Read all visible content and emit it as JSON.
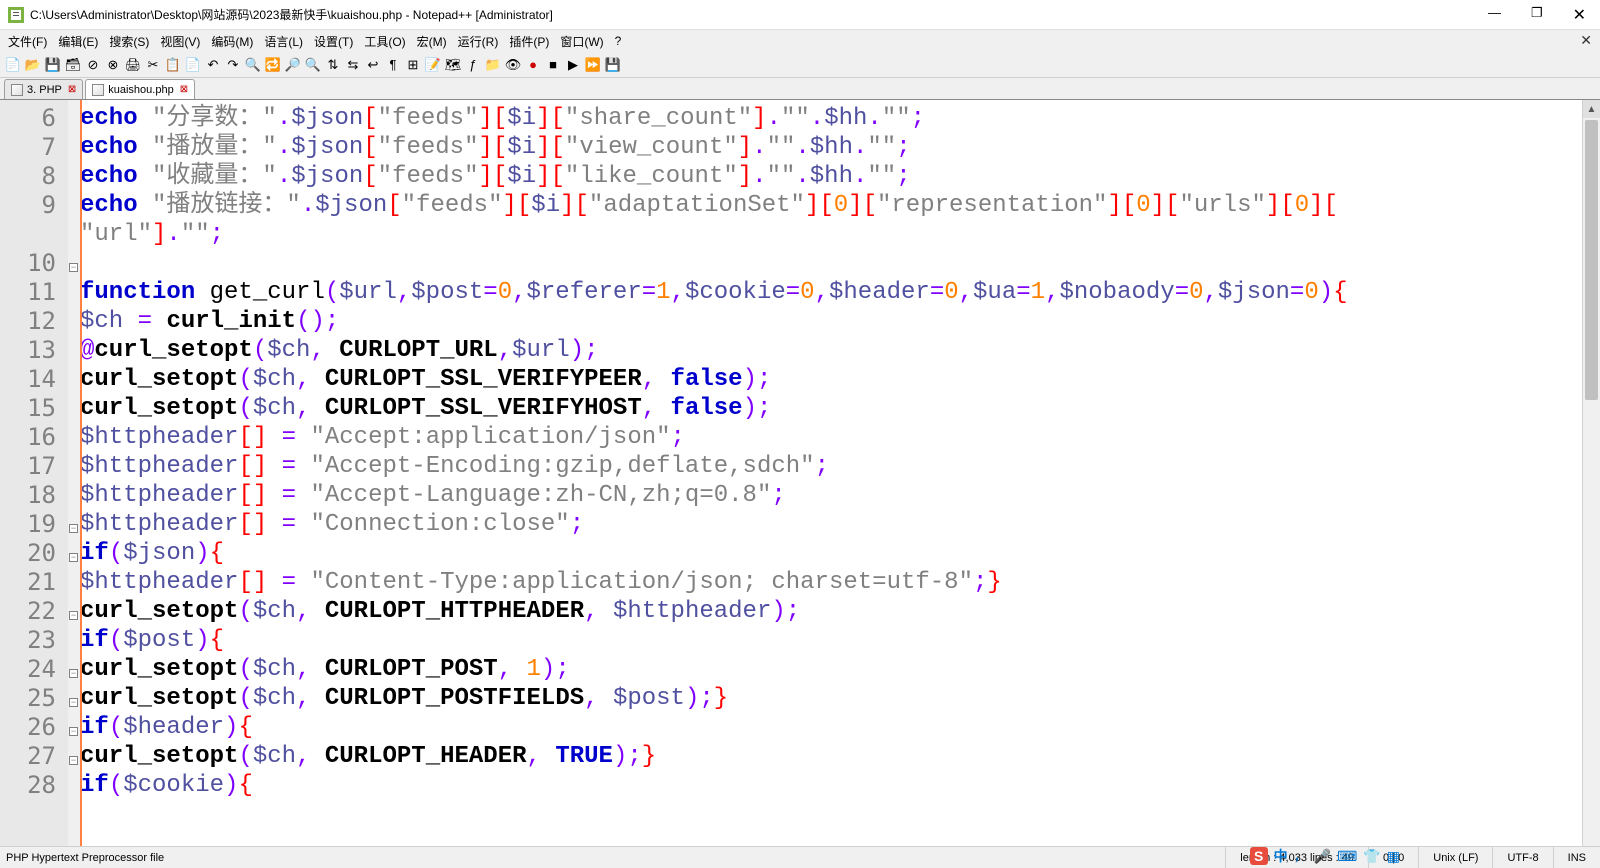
{
  "window": {
    "title": "C:\\Users\\Administrator\\Desktop\\网站源码\\2023最新快手\\kuaishou.php - Notepad++ [Administrator]"
  },
  "menu": {
    "items": [
      "文件(F)",
      "编辑(E)",
      "搜索(S)",
      "视图(V)",
      "编码(M)",
      "语言(L)",
      "设置(T)",
      "工具(O)",
      "宏(M)",
      "运行(R)",
      "插件(P)",
      "窗口(W)",
      "?"
    ]
  },
  "tabs": {
    "t1": "3. PHP",
    "t2": "kuaishou.php"
  },
  "gutter": {
    "start": 6,
    "end": 28
  },
  "fold": {
    "l11": 163,
    "l20": 424,
    "l21": 453,
    "l23": 511,
    "l25": 569,
    "l26": 598,
    "l27": 627,
    "l28": 656
  },
  "code_lines": {
    "l6": [
      [
        "kw",
        "echo"
      ],
      [
        "fn",
        " "
      ],
      [
        "str",
        "\"分享数："
      ],
      [
        "str",
        "\""
      ],
      [
        "op",
        "."
      ],
      [
        "var",
        "$json"
      ],
      [
        "brk",
        "["
      ],
      [
        "str",
        "\"feeds\""
      ],
      [
        "brk",
        "]["
      ],
      [
        "var",
        "$i"
      ],
      [
        "brk",
        "]["
      ],
      [
        "str",
        "\"share_count\""
      ],
      [
        "brk",
        "]"
      ],
      [
        "op",
        "."
      ],
      [
        "str",
        "\"\""
      ],
      [
        "op",
        "."
      ],
      [
        "var",
        "$hh"
      ],
      [
        "op",
        "."
      ],
      [
        "str",
        "\"\""
      ],
      [
        "op",
        ";"
      ]
    ],
    "l7": [
      [
        "kw",
        "echo"
      ],
      [
        "fn",
        " "
      ],
      [
        "str",
        "\"播放量："
      ],
      [
        "str",
        "\""
      ],
      [
        "op",
        "."
      ],
      [
        "var",
        "$json"
      ],
      [
        "brk",
        "["
      ],
      [
        "str",
        "\"feeds\""
      ],
      [
        "brk",
        "]["
      ],
      [
        "var",
        "$i"
      ],
      [
        "brk",
        "]["
      ],
      [
        "str",
        "\"view_count\""
      ],
      [
        "brk",
        "]"
      ],
      [
        "op",
        "."
      ],
      [
        "str",
        "\"\""
      ],
      [
        "op",
        "."
      ],
      [
        "var",
        "$hh"
      ],
      [
        "op",
        "."
      ],
      [
        "str",
        "\"\""
      ],
      [
        "op",
        ";"
      ]
    ],
    "l8": [
      [
        "kw",
        "echo"
      ],
      [
        "fn",
        " "
      ],
      [
        "str",
        "\"收藏量："
      ],
      [
        "str",
        "\""
      ],
      [
        "op",
        "."
      ],
      [
        "var",
        "$json"
      ],
      [
        "brk",
        "["
      ],
      [
        "str",
        "\"feeds\""
      ],
      [
        "brk",
        "]["
      ],
      [
        "var",
        "$i"
      ],
      [
        "brk",
        "]["
      ],
      [
        "str",
        "\"like_count\""
      ],
      [
        "brk",
        "]"
      ],
      [
        "op",
        "."
      ],
      [
        "str",
        "\"\""
      ],
      [
        "op",
        "."
      ],
      [
        "var",
        "$hh"
      ],
      [
        "op",
        "."
      ],
      [
        "str",
        "\"\""
      ],
      [
        "op",
        ";"
      ]
    ],
    "l9": [
      [
        "kw",
        "echo"
      ],
      [
        "fn",
        " "
      ],
      [
        "str",
        "\"播放链接：\""
      ],
      [
        "op",
        "."
      ],
      [
        "var",
        "$json"
      ],
      [
        "brk",
        "["
      ],
      [
        "str",
        "\"feeds\""
      ],
      [
        "brk",
        "]["
      ],
      [
        "var",
        "$i"
      ],
      [
        "brk",
        "]["
      ],
      [
        "str",
        "\"adaptationSet\""
      ],
      [
        "brk",
        "]["
      ],
      [
        "num",
        "0"
      ],
      [
        "brk",
        "]["
      ],
      [
        "str",
        "\"representation\""
      ],
      [
        "brk",
        "]["
      ],
      [
        "num",
        "0"
      ],
      [
        "brk",
        "]["
      ],
      [
        "str",
        "\"urls\""
      ],
      [
        "brk",
        "]["
      ],
      [
        "num",
        "0"
      ],
      [
        "brk",
        "]["
      ]
    ],
    "l9b": [
      [
        "str",
        "\"url\""
      ],
      [
        "brk",
        "]"
      ],
      [
        "op",
        "."
      ],
      [
        "str",
        "\"\""
      ],
      [
        "op",
        ";"
      ]
    ],
    "l10": [],
    "l11": [
      [
        "kw",
        "function"
      ],
      [
        "fn",
        " get_curl"
      ],
      [
        "op",
        "("
      ],
      [
        "var",
        "$url"
      ],
      [
        "op",
        ","
      ],
      [
        "var",
        "$post"
      ],
      [
        "op",
        "="
      ],
      [
        "num",
        "0"
      ],
      [
        "op",
        ","
      ],
      [
        "var",
        "$referer"
      ],
      [
        "op",
        "="
      ],
      [
        "num",
        "1"
      ],
      [
        "op",
        ","
      ],
      [
        "var",
        "$cookie"
      ],
      [
        "op",
        "="
      ],
      [
        "num",
        "0"
      ],
      [
        "op",
        ","
      ],
      [
        "var",
        "$header"
      ],
      [
        "op",
        "="
      ],
      [
        "num",
        "0"
      ],
      [
        "op",
        ","
      ],
      [
        "var",
        "$ua"
      ],
      [
        "op",
        "="
      ],
      [
        "num",
        "1"
      ],
      [
        "op",
        ","
      ],
      [
        "var",
        "$nobaody"
      ],
      [
        "op",
        "="
      ],
      [
        "num",
        "0"
      ],
      [
        "op",
        ","
      ],
      [
        "var",
        "$json"
      ],
      [
        "op",
        "="
      ],
      [
        "num",
        "0"
      ],
      [
        "op",
        ")"
      ],
      [
        "brk",
        "{"
      ]
    ],
    "l12": [
      [
        "var",
        "$ch"
      ],
      [
        "fn",
        " "
      ],
      [
        "op",
        "="
      ],
      [
        "fn",
        " "
      ],
      [
        "cns",
        "curl_init"
      ],
      [
        "op",
        "();"
      ]
    ],
    "l13": [
      [
        "op",
        "@"
      ],
      [
        "cns",
        "curl_setopt"
      ],
      [
        "op",
        "("
      ],
      [
        "var",
        "$ch"
      ],
      [
        "op",
        ","
      ],
      [
        "fn",
        " "
      ],
      [
        "cns",
        "CURLOPT_URL"
      ],
      [
        "op",
        ","
      ],
      [
        "var",
        "$url"
      ],
      [
        "op",
        ");"
      ]
    ],
    "l14": [
      [
        "cns",
        "curl_setopt"
      ],
      [
        "op",
        "("
      ],
      [
        "var",
        "$ch"
      ],
      [
        "op",
        ","
      ],
      [
        "fn",
        " "
      ],
      [
        "cns",
        "CURLOPT_SSL_VERIFYPEER"
      ],
      [
        "op",
        ","
      ],
      [
        "fn",
        " "
      ],
      [
        "kw",
        "false"
      ],
      [
        "op",
        ");"
      ]
    ],
    "l15": [
      [
        "cns",
        "curl_setopt"
      ],
      [
        "op",
        "("
      ],
      [
        "var",
        "$ch"
      ],
      [
        "op",
        ","
      ],
      [
        "fn",
        " "
      ],
      [
        "cns",
        "CURLOPT_SSL_VERIFYHOST"
      ],
      [
        "op",
        ","
      ],
      [
        "fn",
        " "
      ],
      [
        "kw",
        "false"
      ],
      [
        "op",
        ");"
      ]
    ],
    "l16": [
      [
        "var",
        "$httpheader"
      ],
      [
        "brk",
        "[]"
      ],
      [
        "fn",
        " "
      ],
      [
        "op",
        "="
      ],
      [
        "fn",
        " "
      ],
      [
        "str",
        "\"Accept:application/json\""
      ],
      [
        "op",
        ";"
      ]
    ],
    "l17": [
      [
        "var",
        "$httpheader"
      ],
      [
        "brk",
        "[]"
      ],
      [
        "fn",
        " "
      ],
      [
        "op",
        "="
      ],
      [
        "fn",
        " "
      ],
      [
        "str",
        "\"Accept-Encoding:gzip,deflate,sdch\""
      ],
      [
        "op",
        ";"
      ]
    ],
    "l18": [
      [
        "var",
        "$httpheader"
      ],
      [
        "brk",
        "[]"
      ],
      [
        "fn",
        " "
      ],
      [
        "op",
        "="
      ],
      [
        "fn",
        " "
      ],
      [
        "str",
        "\"Accept-Language:zh-CN,zh;q=0.8\""
      ],
      [
        "op",
        ";"
      ]
    ],
    "l19": [
      [
        "var",
        "$httpheader"
      ],
      [
        "brk",
        "[]"
      ],
      [
        "fn",
        " "
      ],
      [
        "op",
        "="
      ],
      [
        "fn",
        " "
      ],
      [
        "str",
        "\"Connection:close\""
      ],
      [
        "op",
        ";"
      ]
    ],
    "l20": [
      [
        "kw",
        "if"
      ],
      [
        "op",
        "("
      ],
      [
        "var",
        "$json"
      ],
      [
        "op",
        ")"
      ],
      [
        "brk",
        "{"
      ]
    ],
    "l21": [
      [
        "var",
        "$httpheader"
      ],
      [
        "brk",
        "[]"
      ],
      [
        "fn",
        " "
      ],
      [
        "op",
        "="
      ],
      [
        "fn",
        " "
      ],
      [
        "str",
        "\"Content-Type:application/json; charset=utf-8\""
      ],
      [
        "op",
        ";"
      ],
      [
        "brk",
        "}"
      ]
    ],
    "l22": [
      [
        "cns",
        "curl_setopt"
      ],
      [
        "op",
        "("
      ],
      [
        "var",
        "$ch"
      ],
      [
        "op",
        ","
      ],
      [
        "fn",
        " "
      ],
      [
        "cns",
        "CURLOPT_HTTPHEADER"
      ],
      [
        "op",
        ","
      ],
      [
        "fn",
        " "
      ],
      [
        "var",
        "$httpheader"
      ],
      [
        "op",
        ");"
      ]
    ],
    "l23": [
      [
        "kw",
        "if"
      ],
      [
        "op",
        "("
      ],
      [
        "var",
        "$post"
      ],
      [
        "op",
        ")"
      ],
      [
        "brk",
        "{"
      ]
    ],
    "l24": [
      [
        "cns",
        "curl_setopt"
      ],
      [
        "op",
        "("
      ],
      [
        "var",
        "$ch"
      ],
      [
        "op",
        ","
      ],
      [
        "fn",
        " "
      ],
      [
        "cns",
        "CURLOPT_POST"
      ],
      [
        "op",
        ","
      ],
      [
        "fn",
        " "
      ],
      [
        "num",
        "1"
      ],
      [
        "op",
        ");"
      ]
    ],
    "l25": [
      [
        "cns",
        "curl_setopt"
      ],
      [
        "op",
        "("
      ],
      [
        "var",
        "$ch"
      ],
      [
        "op",
        ","
      ],
      [
        "fn",
        " "
      ],
      [
        "cns",
        "CURLOPT_POSTFIELDS"
      ],
      [
        "op",
        ","
      ],
      [
        "fn",
        " "
      ],
      [
        "var",
        "$post"
      ],
      [
        "op",
        ");"
      ],
      [
        "brk",
        "}"
      ]
    ],
    "l26": [
      [
        "kw",
        "if"
      ],
      [
        "op",
        "("
      ],
      [
        "var",
        "$header"
      ],
      [
        "op",
        ")"
      ],
      [
        "brk",
        "{"
      ]
    ],
    "l27": [
      [
        "cns",
        "curl_setopt"
      ],
      [
        "op",
        "("
      ],
      [
        "var",
        "$ch"
      ],
      [
        "op",
        ","
      ],
      [
        "fn",
        " "
      ],
      [
        "cns",
        "CURLOPT_HEADER"
      ],
      [
        "op",
        ","
      ],
      [
        "fn",
        " "
      ],
      [
        "kw",
        "TRUE"
      ],
      [
        "op",
        ");"
      ],
      [
        "brk",
        "}"
      ]
    ],
    "l28": [
      [
        "kw",
        "if"
      ],
      [
        "op",
        "("
      ],
      [
        "var",
        "$cookie"
      ],
      [
        "op",
        ")"
      ],
      [
        "brk",
        "{"
      ]
    ]
  },
  "status": {
    "lang": "PHP Hypertext Preprocessor file",
    "length": "length : 4,033    lines : 49",
    "pos": "0 | 0",
    "eol": "Unix (LF)",
    "enc": "UTF-8",
    "ins": "INS"
  },
  "tray": {
    "zh": "中"
  }
}
